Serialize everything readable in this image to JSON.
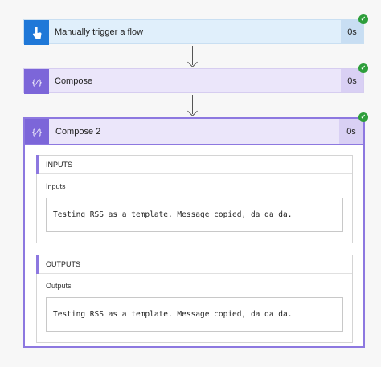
{
  "flow": {
    "steps": [
      {
        "title": "Manually trigger a flow",
        "duration": "0s",
        "icon": "hand-tap-icon",
        "status": "succeeded"
      },
      {
        "title": "Compose",
        "duration": "0s",
        "icon": "code-braces-icon",
        "status": "succeeded"
      },
      {
        "title": "Compose 2",
        "duration": "0s",
        "icon": "code-braces-icon",
        "status": "succeeded"
      }
    ],
    "details": {
      "inputs": {
        "section": "INPUTS",
        "label": "Inputs",
        "value": "Testing RSS as a template. Message copied, da da da."
      },
      "outputs": {
        "section": "OUTPUTS",
        "label": "Outputs",
        "value": "Testing RSS as a template. Message copied, da da da."
      }
    }
  },
  "colors": {
    "trigger_accent": "#1f78d8",
    "compose_accent": "#7c66d9",
    "success": "#2e9e3b"
  }
}
